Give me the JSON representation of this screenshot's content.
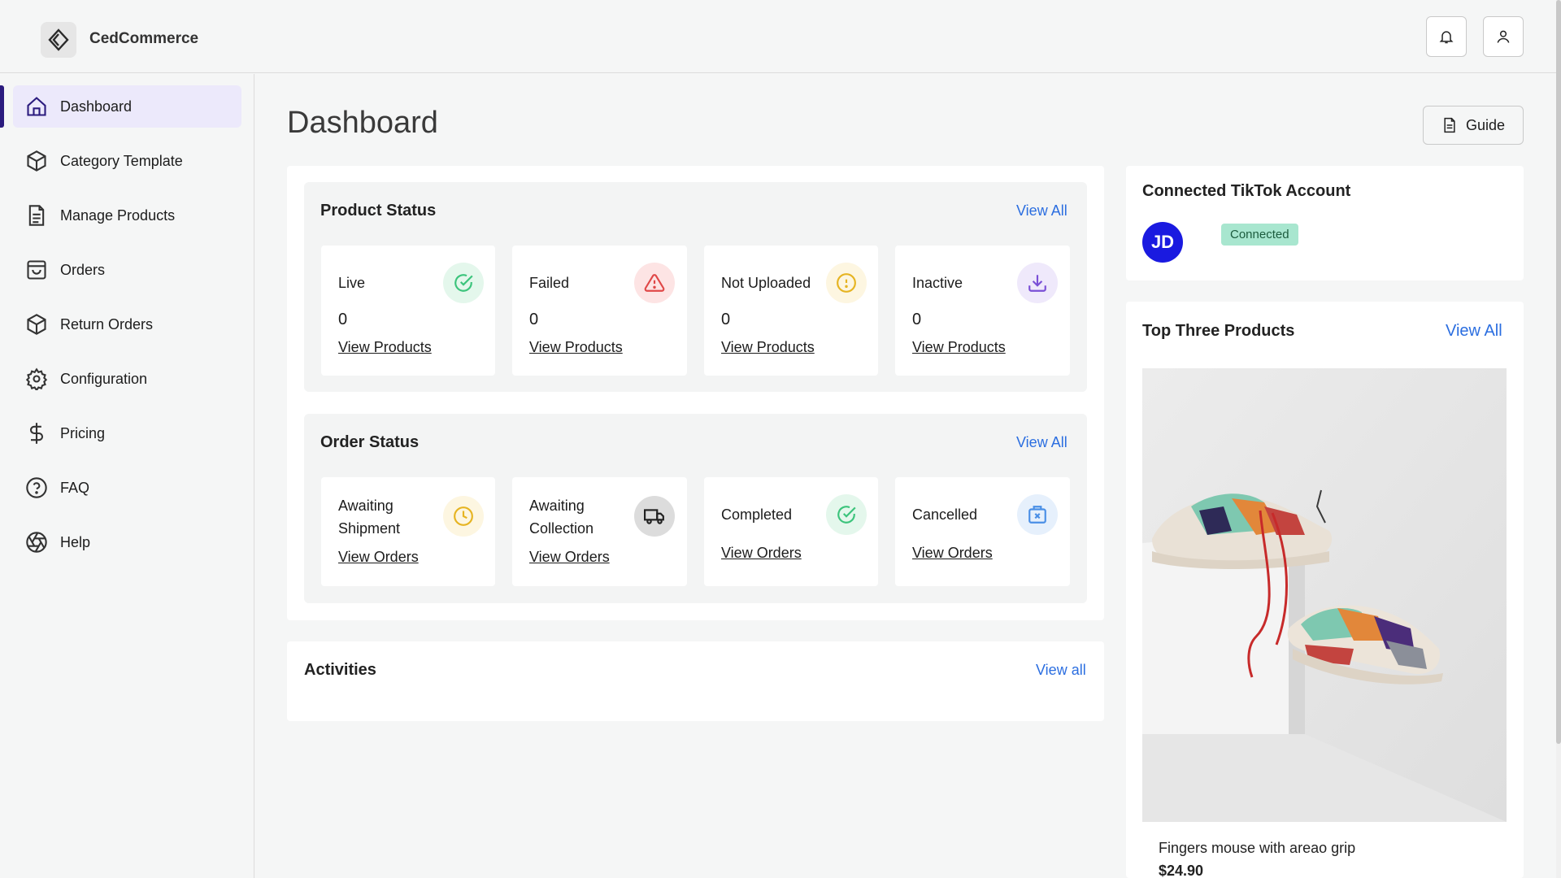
{
  "brand": {
    "name": "CedCommerce"
  },
  "sidebar": {
    "items": [
      {
        "label": "Dashboard",
        "icon": "home-icon",
        "active": true
      },
      {
        "label": "Category Template",
        "icon": "box-icon"
      },
      {
        "label": "Manage Products",
        "icon": "document-icon"
      },
      {
        "label": "Orders",
        "icon": "shopping-bag-icon"
      },
      {
        "label": "Return Orders",
        "icon": "box-return-icon"
      },
      {
        "label": "Configuration",
        "icon": "gear-icon"
      },
      {
        "label": "Pricing",
        "icon": "dollar-icon"
      },
      {
        "label": "FAQ",
        "icon": "question-icon"
      },
      {
        "label": "Help",
        "icon": "aperture-icon"
      }
    ]
  },
  "header": {
    "title": "Dashboard",
    "guide_label": "Guide"
  },
  "product_status": {
    "title": "Product Status",
    "view_all": "View All",
    "cards": [
      {
        "label": "Live",
        "count": "0",
        "link": "View Products",
        "icon": "check-circle-icon",
        "color": "#3cc47c",
        "bg": "#e4f7ec"
      },
      {
        "label": "Failed",
        "count": "0",
        "link": "View Products",
        "icon": "warning-icon",
        "color": "#e04848",
        "bg": "#fde4e4"
      },
      {
        "label": "Not Uploaded",
        "count": "0",
        "link": "View Products",
        "icon": "alert-circle-icon",
        "color": "#e6b422",
        "bg": "#fdf6e1"
      },
      {
        "label": "Inactive",
        "count": "0",
        "link": "View Products",
        "icon": "download-icon",
        "color": "#7a4fd6",
        "bg": "#efe9fb"
      }
    ]
  },
  "order_status": {
    "title": "Order Status",
    "view_all": "View All",
    "cards": [
      {
        "label_line1": "Awaiting",
        "label_line2": "Shipment",
        "link": "View Orders",
        "icon": "clock-icon",
        "color": "#e6b422",
        "bg": "#fdf6e1"
      },
      {
        "label_line1": "Awaiting",
        "label_line2": "Collection",
        "link": "View Orders",
        "icon": "truck-icon",
        "color": "#222222",
        "bg": "#dcdcdc"
      },
      {
        "label": "Completed",
        "link": "View Orders",
        "icon": "check-circle-icon",
        "color": "#3cc47c",
        "bg": "#e4f7ec"
      },
      {
        "label": "Cancelled",
        "link": "View Orders",
        "icon": "cancel-box-icon",
        "color": "#4a8fe6",
        "bg": "#e6f0fc"
      }
    ]
  },
  "activities": {
    "title": "Activities",
    "view_all": "View all"
  },
  "tiktok": {
    "title": "Connected TikTok Account",
    "avatar_initials": "JD",
    "status": "Connected"
  },
  "top_products": {
    "title": "Top Three Products",
    "view_all": "View All",
    "product": {
      "name": "Fingers mouse with areao grip",
      "price": "$24.90",
      "image": "sneakers-photo"
    }
  }
}
